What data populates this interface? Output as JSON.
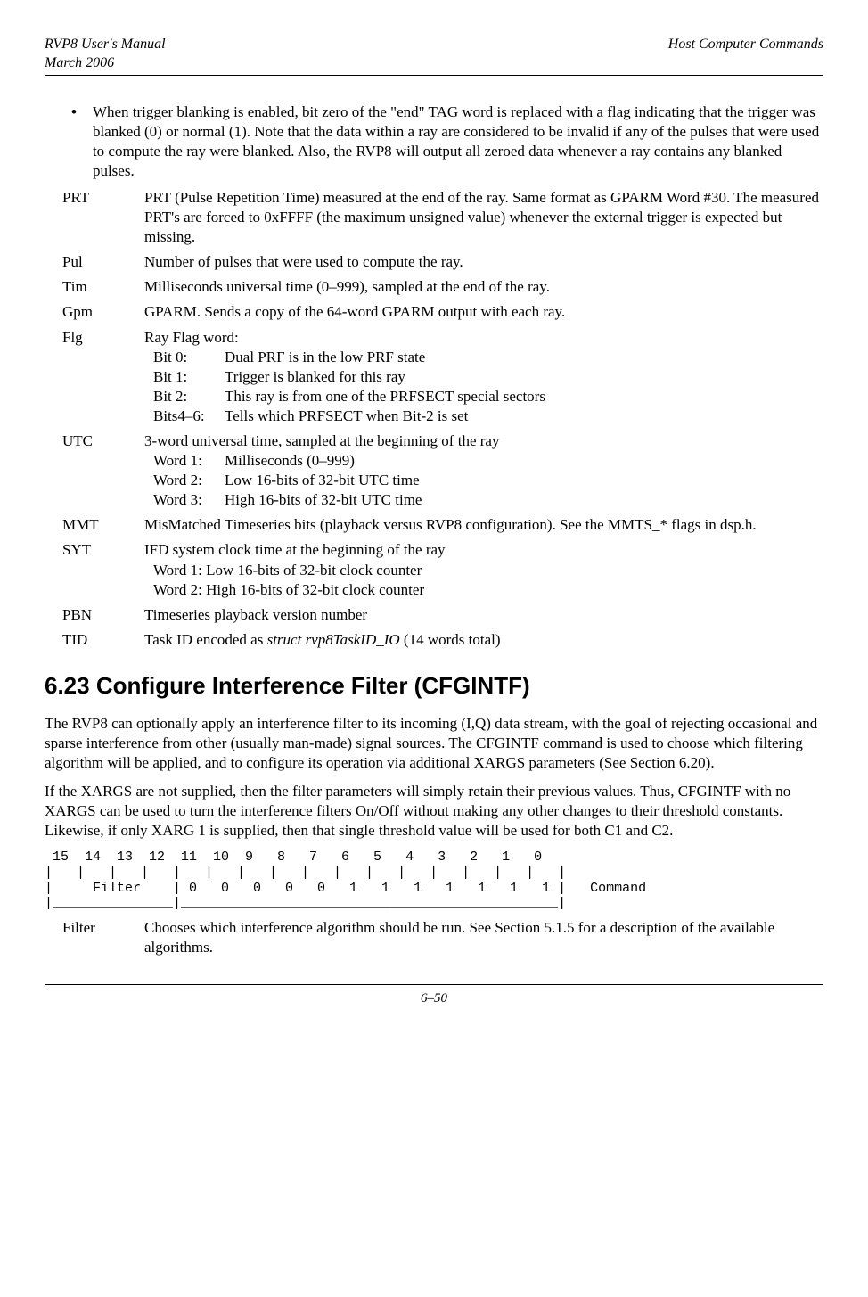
{
  "header": {
    "left_line1": "RVP8 User's Manual",
    "left_line2": "March 2006",
    "right": "Host Computer Commands"
  },
  "bullet": {
    "text": "When trigger blanking is enabled, bit zero of the \"end\" TAG word is replaced with a flag indicating that the trigger was blanked (0) or normal (1).  Note that the data within a ray are considered to be invalid if any of the pulses that were used to compute the ray were blanked.  Also, the RVP8 will output all zeroed data whenever a ray contains any blanked pulses."
  },
  "defs": {
    "prt": {
      "term": "PRT",
      "body": "PRT (Pulse Repetition Time) measured at the end of the ray.  Same format as GPARM Word #30.  The measured PRT's  are forced to 0xFFFF (the maximum unsigned value) whenever the external trigger is expected but missing."
    },
    "pul": {
      "term": "Pul",
      "body": "Number of pulses that were used to compute the ray."
    },
    "tim": {
      "term": "Tim",
      "body": "Milliseconds universal time (0–999), sampled at the end of the ray."
    },
    "gpm": {
      "term": "Gpm",
      "body": "GPARM.  Sends a copy of the 64-word GPARM output with each ray."
    },
    "flg": {
      "term": "Flg",
      "intro": "Ray Flag word:",
      "b0": {
        "label": "Bit 0:",
        "txt": "Dual PRF is in the low PRF state"
      },
      "b1": {
        "label": "Bit 1:",
        "txt": "Trigger is blanked for this ray"
      },
      "b2": {
        "label": "Bit 2:",
        "txt": "This ray is from one of the PRFSECT special sectors"
      },
      "b46": {
        "label": "Bits4–6:",
        "txt": "Tells which PRFSECT when Bit-2 is set"
      }
    },
    "utc": {
      "term": "UTC",
      "intro": "3-word universal time, sampled at the beginning of the ray",
      "w1": {
        "label": "Word 1:",
        "txt": "Milliseconds (0–999)"
      },
      "w2": {
        "label": "Word 2:",
        "txt": "Low 16-bits of 32-bit UTC time"
      },
      "w3": {
        "label": "Word 3:",
        "txt": "High 16-bits of 32-bit UTC time"
      }
    },
    "mmt": {
      "term": "MMT",
      "body": "MisMatched Timeseries bits (playback versus RVP8 configuration).  See the MMTS_* flags in dsp.h."
    },
    "syt": {
      "term": "SYT",
      "intro": "IFD system clock time at the beginning of the ray",
      "w1": "Word 1: Low 16-bits of 32-bit clock counter",
      "w2": "Word 2: High 16-bits of 32-bit clock counter"
    },
    "pbn": {
      "term": "PBN",
      "body": "Timeseries playback version number"
    },
    "tid": {
      "term": "TID",
      "pre": "Task ID encoded as ",
      "ital": "struct rvp8TaskID_IO",
      "post": " (14 words total)"
    }
  },
  "section": {
    "title": "6.23     Configure Interference Filter (CFGINTF)",
    "p1": "The RVP8 can optionally apply an interference filter to its incoming (I,Q) data stream, with the goal of rejecting occasional and sparse interference from other (usually man-made) signal sources.  The CFGINTF command is used to choose which filtering algorithm will be applied, and to configure its operation via additional XARGS parameters (See Section 6.20).",
    "p2": "If the XARGS are not supplied, then the filter parameters will simply retain their previous values.  Thus, CFGINTF with no XARGS can be used to turn the interference filters On/Off without making any other changes to their threshold constants.  Likewise, if only XARG 1 is supplied, then that single threshold value will be used for both C1 and C2."
  },
  "ascii": " 15  14  13  12  11  10  9   8   7   6   5   4   3   2   1   0 \n|   |   |   |   |   |   |   |   |   |   |   |   |   |   |   |   |\n|     Filter    | 0   0   0   0   0   1   1   1   1   1   1   1 |   Command\n|_______________|_______________________________________________|",
  "filter": {
    "term": "Filter",
    "body": "Chooses which interference algorithm should be run.  See Section 5.1.5 for a description of the available algorithms."
  },
  "footer": "6–50",
  "chart_data": {
    "type": "table",
    "title": "CFGINTF Command Word Bit Layout",
    "bits": [
      15,
      14,
      13,
      12,
      11,
      10,
      9,
      8,
      7,
      6,
      5,
      4,
      3,
      2,
      1,
      0
    ],
    "fields": [
      {
        "name": "Filter",
        "bits": [
          15,
          14,
          13,
          12
        ]
      },
      {
        "name": "Command",
        "bits": [
          11,
          10,
          9,
          8,
          7,
          6,
          5,
          4,
          3,
          2,
          1,
          0
        ],
        "value_bits": [
          0,
          0,
          0,
          0,
          0,
          1,
          1,
          1,
          1,
          1,
          1,
          1
        ]
      }
    ]
  }
}
